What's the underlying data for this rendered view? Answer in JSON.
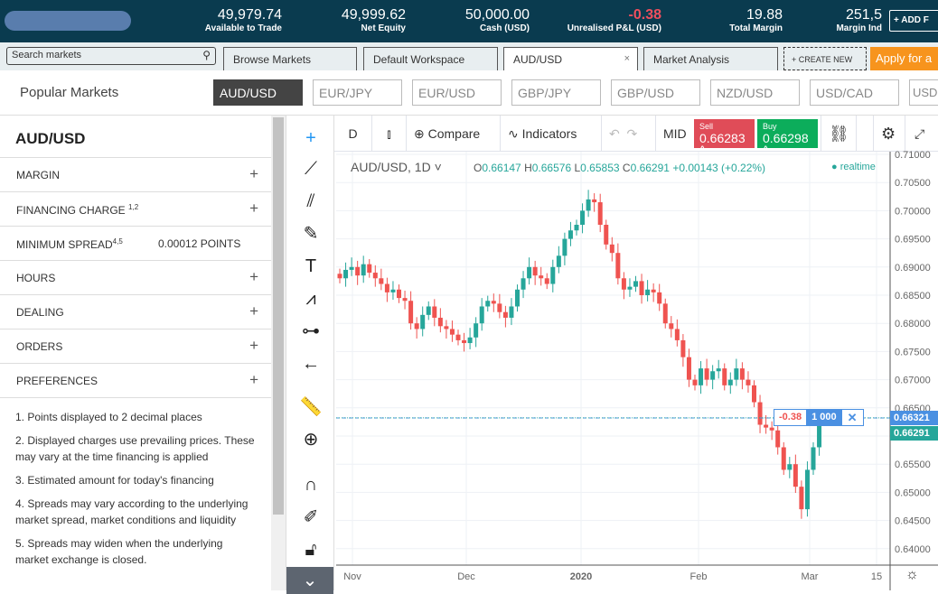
{
  "header": {
    "stats": [
      {
        "value": "49,979.74",
        "label": "Available to Trade"
      },
      {
        "value": "49,999.62",
        "label": "Net Equity"
      },
      {
        "value": "50,000.00",
        "label": "Cash (USD)"
      },
      {
        "value": "-0.38",
        "label": "Unrealised P&L (USD)"
      },
      {
        "value": "19.88",
        "label": "Total Margin"
      },
      {
        "value": "251,5",
        "label": "Margin Ind"
      }
    ],
    "add_button": "+ ADD F"
  },
  "tabs": {
    "search_placeholder": "Search markets",
    "items": [
      "Browse Markets",
      "Default Workspace",
      "AUD/USD",
      "Market Analysis"
    ],
    "close": "×",
    "create_new": "+ CREATE NEW",
    "apply": "Apply for a"
  },
  "popular": {
    "label": "Popular Markets",
    "markets": [
      "AUD/USD",
      "EUR/JPY",
      "EUR/USD",
      "GBP/JPY",
      "GBP/USD",
      "NZD/USD",
      "USD/CAD",
      "USD"
    ]
  },
  "left": {
    "title": "AUD/USD",
    "sections": [
      "MARGIN",
      "FINANCING CHARGE",
      "MINIMUM SPREAD",
      "HOURS",
      "DEALING",
      "ORDERS",
      "PREFERENCES"
    ],
    "financing_sup": "1,2",
    "spread_sup": "4,5",
    "spread_value": "0.00012 POINTS",
    "notes": [
      "1. Points displayed to 2 decimal places",
      "2. Displayed charges use prevailing prices. These may vary at the time financing is applied",
      "3. Estimated amount for today's financing",
      "4. Spreads may vary according to the underlying market spread, market conditions and liquidity",
      "5. Spreads may widen when the underlying market exchange is closed."
    ]
  },
  "toolbar": {
    "interval": "D",
    "compare": "Compare",
    "indicators": "Indicators",
    "mid": "MID",
    "sell_label": "Sell",
    "sell_price": "0.66283",
    "buy_label": "Buy",
    "buy_price": "0.66298"
  },
  "legend": {
    "symbol": "AUD/USD, 1D",
    "o": "0.66147",
    "h": "0.66576",
    "l": "0.65853",
    "c": "0.66291",
    "change": "+0.00143 (+0.22%)",
    "realtime": "realtime"
  },
  "position": {
    "pnl": "-0.38",
    "size": "1 000",
    "price": "0.66321"
  },
  "colors": {
    "up": "#26a69a",
    "down": "#ef5350",
    "header": "#0a3b4f",
    "accent": "#f7941d"
  },
  "chart_data": {
    "type": "candlestick",
    "symbol": "AUD/USD",
    "interval": "1D",
    "y_ticks": [
      "0.71000",
      "0.70500",
      "0.70000",
      "0.69500",
      "0.69000",
      "0.68500",
      "0.68000",
      "0.67500",
      "0.67000",
      "0.66500",
      "0.66000",
      "0.65500",
      "0.65000",
      "0.64500",
      "0.64000"
    ],
    "ylim": [
      0.639,
      0.7115
    ],
    "x_ticks": [
      "Nov",
      "Dec",
      "2020",
      "Feb",
      "Mar",
      "15"
    ],
    "last_price": "0.66291",
    "closes": [
      0.688,
      0.6895,
      0.69,
      0.6885,
      0.6905,
      0.689,
      0.688,
      0.687,
      0.6855,
      0.686,
      0.6845,
      0.684,
      0.68,
      0.679,
      0.6815,
      0.683,
      0.681,
      0.6795,
      0.679,
      0.678,
      0.677,
      0.6765,
      0.6775,
      0.68,
      0.683,
      0.684,
      0.6835,
      0.682,
      0.681,
      0.683,
      0.686,
      0.688,
      0.69,
      0.6885,
      0.688,
      0.687,
      0.69,
      0.692,
      0.695,
      0.6965,
      0.6975,
      0.7,
      0.702,
      0.7015,
      0.6975,
      0.694,
      0.6925,
      0.688,
      0.686,
      0.6865,
      0.6875,
      0.685,
      0.686,
      0.6855,
      0.6835,
      0.68,
      0.679,
      0.677,
      0.674,
      0.67,
      0.669,
      0.672,
      0.67,
      0.6715,
      0.672,
      0.669,
      0.67,
      0.672,
      0.67,
      0.669,
      0.666,
      0.662,
      0.6615,
      0.661,
      0.658,
      0.654,
      0.655,
      0.651,
      0.647,
      0.654,
      0.658,
      0.663,
      0.6629
    ]
  }
}
